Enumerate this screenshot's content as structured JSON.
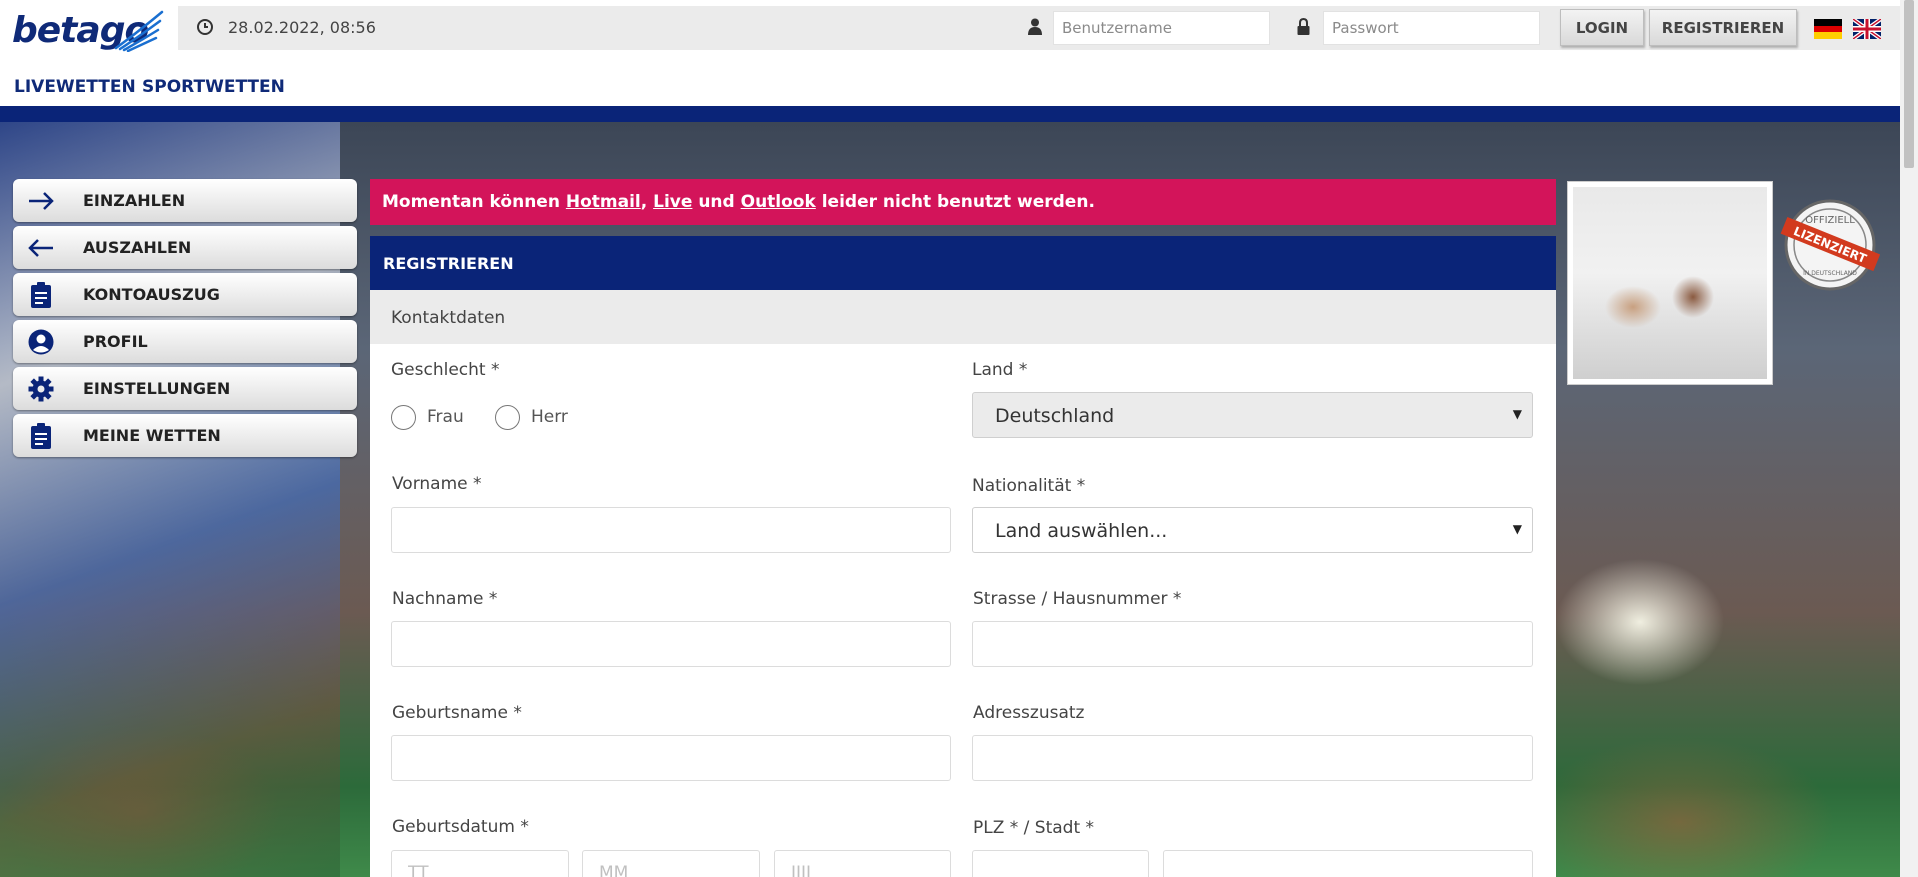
{
  "header": {
    "logo_text": "betago",
    "datetime": "28.02.2022, 08:56",
    "username_placeholder": "Benutzername",
    "password_placeholder": "Passwort",
    "login_label": "LOGIN",
    "register_label": "REGISTRIEREN",
    "languages": [
      "de-flag",
      "uk-flag"
    ]
  },
  "nav": {
    "items": [
      "LIVEWETTEN",
      "SPORTWETTEN"
    ]
  },
  "sidebar": {
    "items": [
      {
        "label": "EINZAHLEN",
        "icon": "arrow-right-icon"
      },
      {
        "label": "AUSZAHLEN",
        "icon": "arrow-left-icon"
      },
      {
        "label": "KONTOAUSZUG",
        "icon": "clipboard-icon"
      },
      {
        "label": "PROFIL",
        "icon": "user-circle-icon"
      },
      {
        "label": "EINSTELLUNGEN",
        "icon": "gear-icon"
      },
      {
        "label": "MEINE WETTEN",
        "icon": "clipboard-icon"
      }
    ]
  },
  "alert": {
    "prefix": "Momentan können ",
    "link1": "Hotmail",
    "sep1": ", ",
    "link2": "Live",
    "sep2": " und ",
    "link3": "Outlook",
    "suffix": " leider nicht benutzt werden."
  },
  "form": {
    "title": "REGISTRIEREN",
    "section": "Kontaktdaten",
    "gender_label": "Geschlecht *",
    "gender_options": [
      "Frau",
      "Herr"
    ],
    "country_label": "Land *",
    "country_value": "Deutschland",
    "firstname_label": "Vorname *",
    "nationality_label": "Nationalität *",
    "nationality_value": "Land auswählen...",
    "lastname_label": "Nachname *",
    "street_label": "Strasse / Hausnummer *",
    "birthname_label": "Geburtsname *",
    "address_extra_label": "Adresszusatz",
    "birthdate_label": "Geburtsdatum *",
    "birthdate_placeholders": [
      "TT",
      "MM",
      "JJJJ"
    ],
    "zip_city_label": "PLZ * / Stadt *"
  },
  "promo": {
    "badge_text": "LIZENZIERT",
    "badge_top": "OFFIZIELL",
    "badge_bottom": "IN DEUTSCHLAND"
  },
  "colors": {
    "brand_blue": "#0a2478",
    "alert_pink": "#d3145a"
  }
}
